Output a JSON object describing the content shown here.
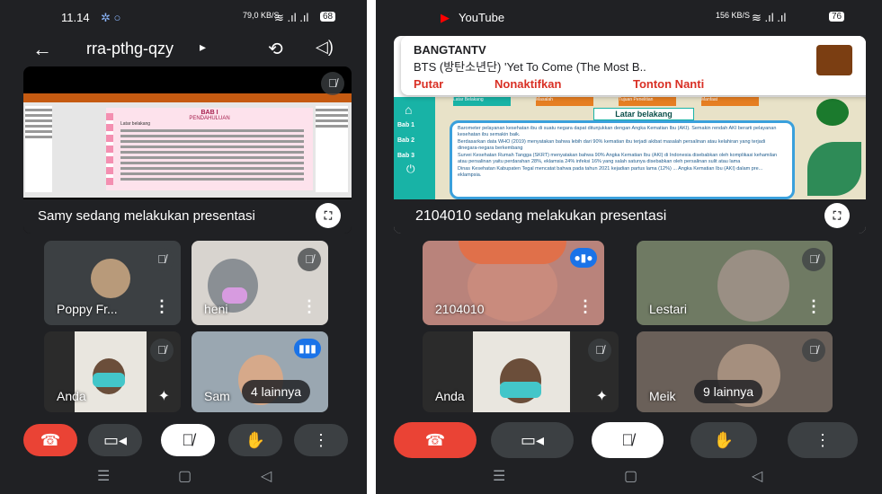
{
  "left": {
    "status": {
      "time": "11.14",
      "speed": "79,0 KB/S",
      "battery": "68"
    },
    "meeting_code": "rra-pthg-qzy",
    "caret": "▸",
    "presentation": {
      "caption": "Samy sedang melakukan presentasi",
      "slide_title": "BAB I",
      "slide_subtitle": "PENDAHULUAN",
      "slide_heading": "Latar belakang"
    },
    "tiles": [
      {
        "name": "Poppy Fr..."
      },
      {
        "name": "heni"
      },
      {
        "name": "Anda"
      },
      {
        "name": "Sam"
      }
    ],
    "others": "4 lainnya"
  },
  "right": {
    "status": {
      "app": "YouTube",
      "speed": "156 KB/S",
      "battery": "76"
    },
    "notification": {
      "channel": "BANGTANTV",
      "title": "BTS (방탄소년단) 'Yet To Come (The Most B..",
      "actions": [
        "Putar",
        "Nonaktifkan",
        "Tonton Nanti"
      ]
    },
    "presentation": {
      "caption": "2104010 sedang melakukan presentasi",
      "tabs": [
        "Latar Belakang",
        "Masalah",
        "Tujuan Penelitian",
        "Manfaat"
      ],
      "sidebar": [
        "Bab 1",
        "Bab 2",
        "Bab 3"
      ],
      "slide_heading": "Latar belakang",
      "bullets": [
        "Barometer pelayanan kesehatan ibu di suatu negara dapat ditunjukkan dengan Angka Kematian Ibu (AKI). Semakin rendah AKI berarti pelayanan kesehatan ibu semakin baik.",
        "Berdasarkan data WHO (2019) menyatakan bahwa lebih dari 90% kematian ibu terjadi akibat masalah persalinan atau kelahiran yang terjadi dinegara-negara berkembang",
        "Survei Kesehatan Rumah Tangga (SKRT) menyatakan bahwa 90% Angka Kematian Ibu (AKI) di Indonesia disebabkan oleh komplikasi kehamilan atau persalinan yaitu perdarahan 28%, eklamsia 24% infeksi 16% yang salah satunya disebabkan oleh persalinan sulit atau lama",
        "Dinas Kesehatan Kabupaten Tegal mencatat bahwa pada tahun 2021 kejadian partus lama (12%) ... Angka Kematian Ibu (AKI) dalam pre... eklampsia."
      ]
    },
    "tiles": [
      {
        "name": "2104010"
      },
      {
        "name": "Lestari"
      },
      {
        "name": "Anda"
      },
      {
        "name": "Meik"
      }
    ],
    "others": "9 lainnya"
  },
  "icons": {
    "hangup": "phone-hangup-icon",
    "camera": "camera-icon",
    "mic_off": "mic-off-icon",
    "raise_hand": "hand-icon",
    "more": "more-icon"
  },
  "colors": {
    "hangup": "#ea4335",
    "speaking": "#1a73e8",
    "notification_action": "#d93025",
    "slide_teal": "#18b3a6"
  }
}
